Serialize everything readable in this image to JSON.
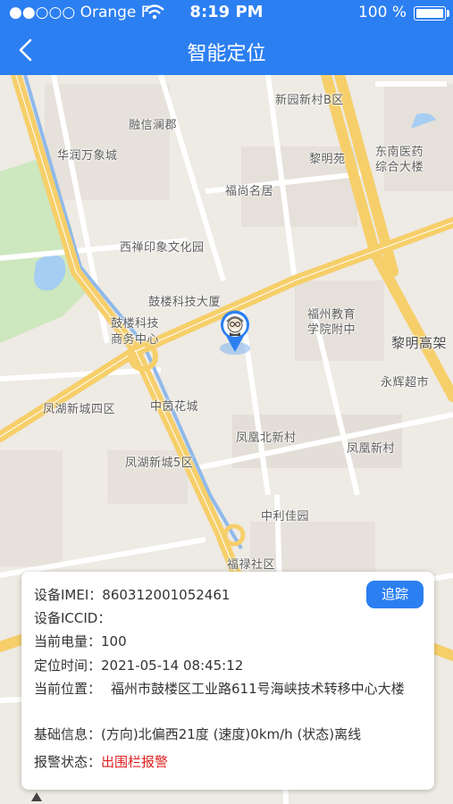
{
  "status_bar": {
    "carrier": "●●○○○ Orange F",
    "time": "8:19 PM",
    "battery": "100 %"
  },
  "nav": {
    "title": "智能定位",
    "back_icon": "chevron-left-icon"
  },
  "map": {
    "labels": [
      "新园新村B区",
      "融信澜郡",
      "华润万象城",
      "东南医药",
      "综合大楼",
      "黎明苑",
      "福尚名居",
      "西禅印象文化园",
      "鼓楼科技大厦",
      "鼓楼科技",
      "商务中心",
      "福州教育",
      "学院附中",
      "黎明高架",
      "永辉超市",
      "凤湖新城四区",
      "中茵花城",
      "凤凰北新村",
      "凤凰新村",
      "凤湖新城5区",
      "中利佳园",
      "福禄社区"
    ],
    "marker_icon": "elderly-person-avatar-pin-icon"
  },
  "info": {
    "imei_label": "设备IMEI：",
    "imei": "860312001052461",
    "iccid_label": "设备ICCID：",
    "iccid": "",
    "battery_label": "当前电量：",
    "battery": "100",
    "time_label": "定位时间：",
    "time": "2021-05-14 08:45:12",
    "address_label": "当前位置：",
    "address": "福州市鼓楼区工业路611号海峡技术转移中心大楼",
    "basic_label": "基础信息：",
    "basic": "(方向)北偏西21度 (速度)0km/h (状态)离线",
    "alarm_label": "报警状态：",
    "alarm": "出围栏报警",
    "track_button": "追踪"
  },
  "colors": {
    "primary": "#2c7ff1",
    "alarm": "#e02020",
    "road_major": "#f6cf6a",
    "map_bg": "#eeeae4"
  }
}
